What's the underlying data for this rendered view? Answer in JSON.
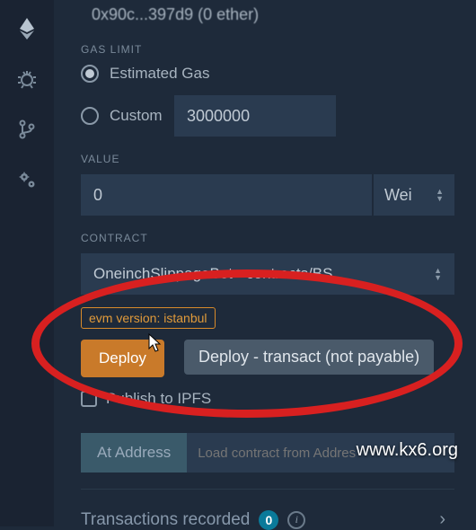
{
  "truncated_account": "0x90c...397d9 (0 ether)",
  "gas": {
    "label": "GAS LIMIT",
    "estimated_label": "Estimated Gas",
    "custom_label": "Custom",
    "custom_value": "3000000"
  },
  "value": {
    "label": "VALUE",
    "amount": "0",
    "unit": "Wei"
  },
  "contract": {
    "label": "CONTRACT",
    "selected": "OneinchSlippageBot - contracts/BS"
  },
  "evm_tag": "evm version: istanbul",
  "deploy": {
    "label": "Deploy",
    "tooltip": "Deploy - transact (not payable)"
  },
  "publish_label": "Publish to IPFS",
  "at_address_label": "At Address",
  "load_placeholder": "Load contract from Addres",
  "watermark": "www.kx6.org",
  "tx": {
    "label": "Transactions recorded",
    "count": "0"
  }
}
